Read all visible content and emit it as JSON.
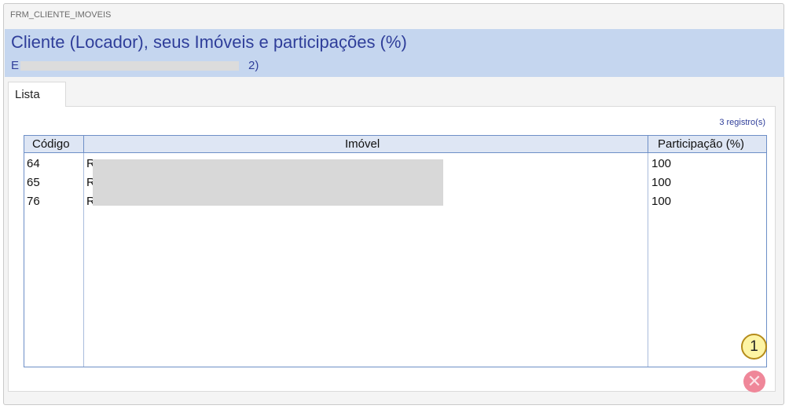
{
  "form": {
    "name": "FRM_CLIENTE_IMOVEIS",
    "title": "Cliente (Locador), seus Imóveis e participações (%)",
    "subtitle_start": "E",
    "subtitle_end": "2)"
  },
  "tabs": [
    {
      "label": "Lista"
    }
  ],
  "record_count": "3 registro(s)",
  "grid": {
    "columns": [
      "Código",
      "Imóvel",
      "Participação (%)"
    ],
    "rows": [
      {
        "codigo": "64",
        "imovel": "R",
        "participacao": "100"
      },
      {
        "codigo": "65",
        "imovel": "R",
        "participacao": "100"
      },
      {
        "codigo": "76",
        "imovel": "R",
        "participacao": "100"
      }
    ]
  },
  "badge": {
    "number": "1"
  },
  "icons": {
    "close": "close-icon"
  }
}
